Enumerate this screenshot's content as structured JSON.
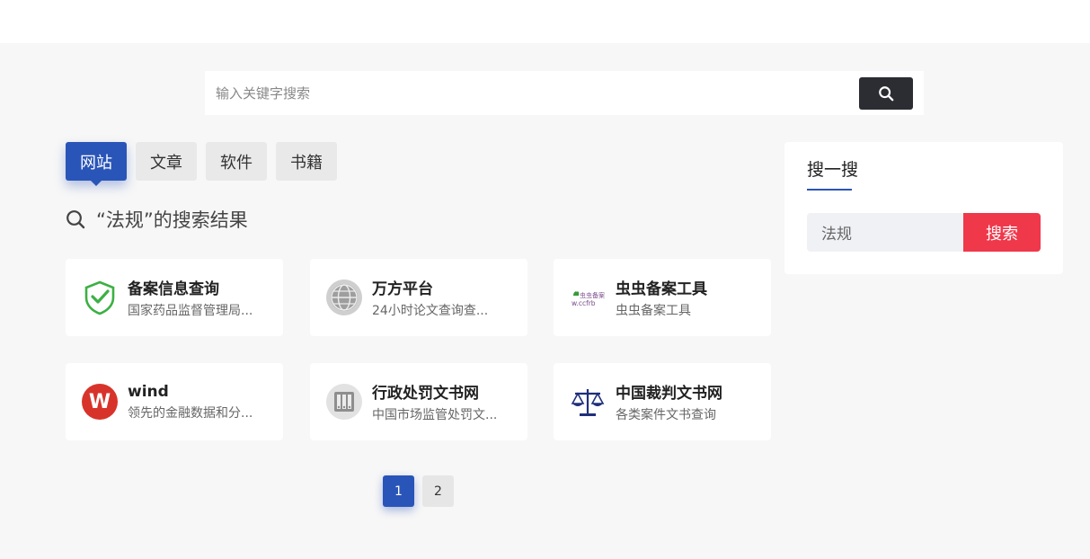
{
  "search": {
    "placeholder": "输入关键字搜索"
  },
  "tabs": [
    {
      "label": "网站",
      "active": true
    },
    {
      "label": "文章"
    },
    {
      "label": "软件"
    },
    {
      "label": "书籍"
    }
  ],
  "results_title": "“法规”的搜索结果",
  "cards": [
    {
      "name": "备案信息查询",
      "desc": "国家药品监督管理局...",
      "icon": "shield-check-icon"
    },
    {
      "name": "万方平台",
      "desc": "24小时论文查询查...",
      "icon": "globe-icon"
    },
    {
      "name": "虫虫备案工具",
      "desc": "虫虫备案工具",
      "icon": "ccfrb-logo-icon",
      "logo_text": "虫虫备案"
    },
    {
      "name": "wind",
      "desc": "领先的金融数据和分...",
      "icon": "wind-logo-icon",
      "logo_text": "W"
    },
    {
      "name": "行政处罚文书网",
      "desc": "中国市场监管处罚文...",
      "icon": "archive-icon"
    },
    {
      "name": "中国裁判文书网",
      "desc": "各类案件文书查询",
      "icon": "scales-icon"
    }
  ],
  "pagination": [
    {
      "label": "1",
      "active": true
    },
    {
      "label": "2"
    }
  ],
  "sidebar": {
    "title": "搜一搜",
    "field_value": "法规",
    "button_label": "搜索"
  }
}
